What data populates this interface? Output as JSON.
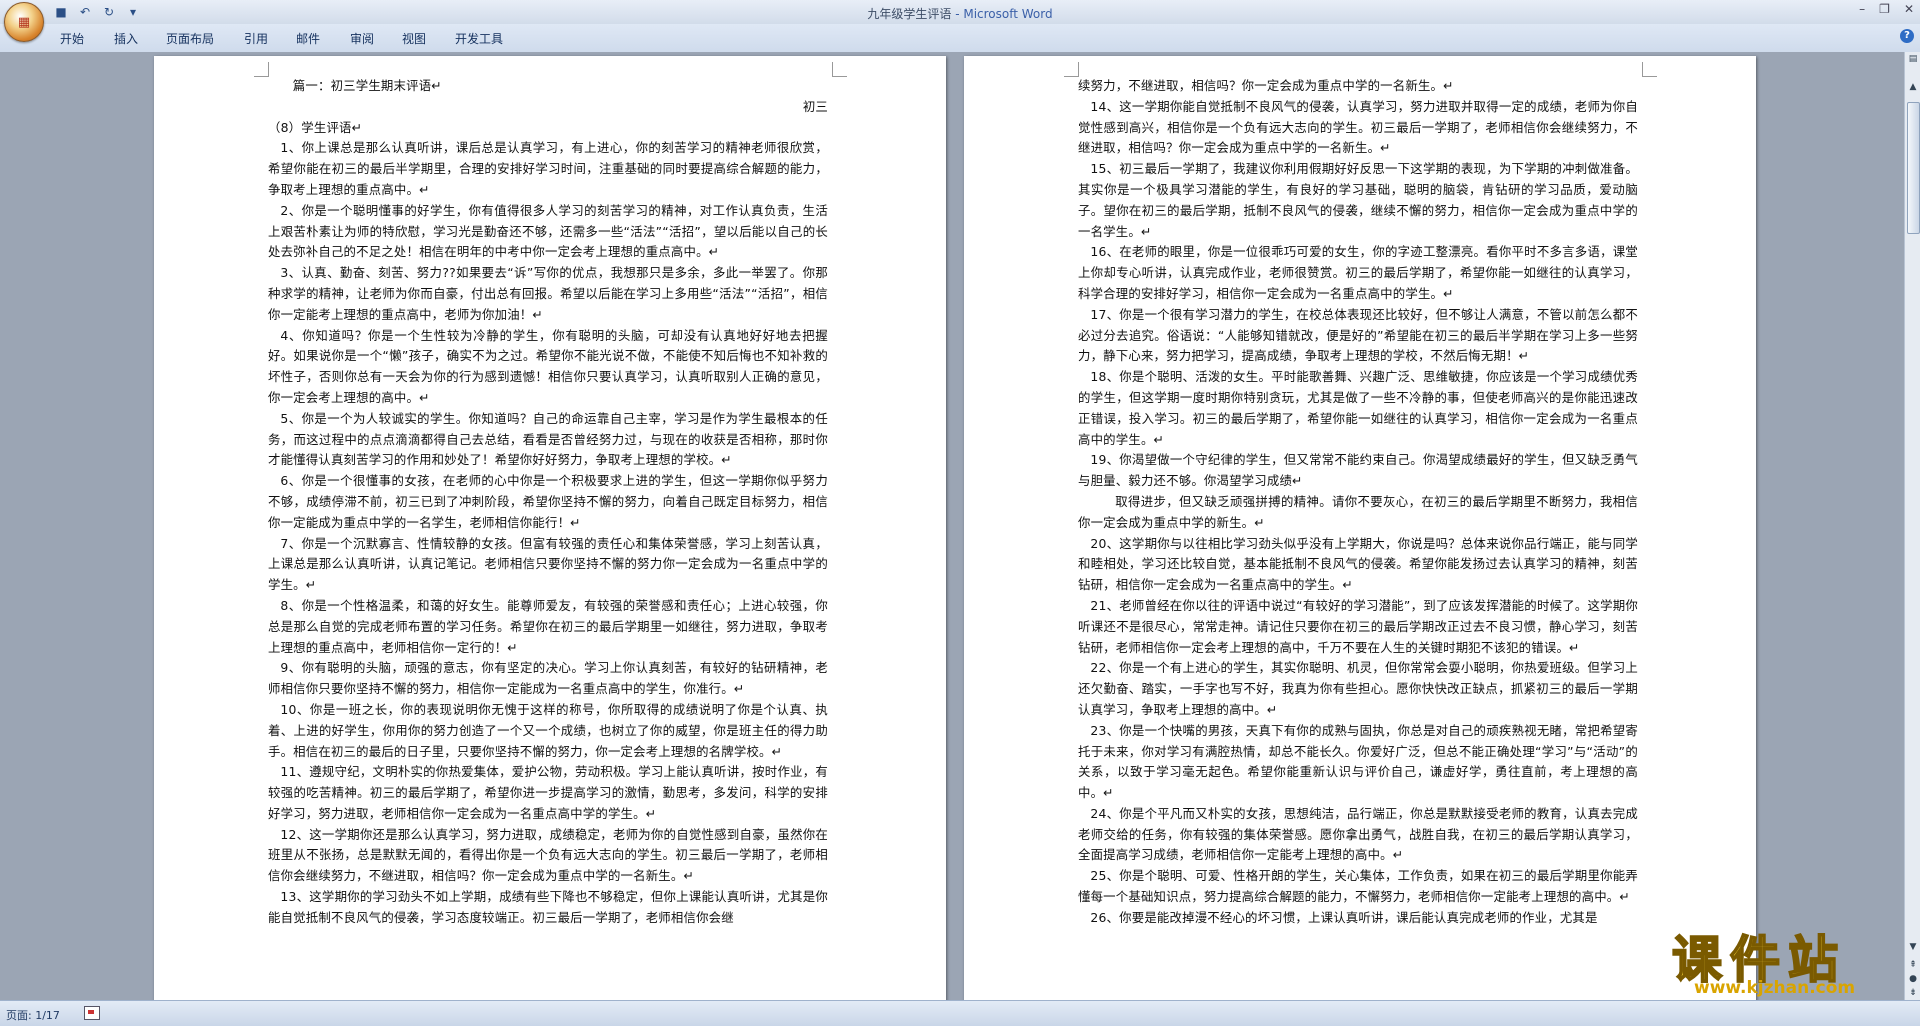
{
  "window": {
    "doc_title": "九年级学生评语",
    "app_title": " - Microsoft Word"
  },
  "office_button": {
    "icon": "office-logo-icon"
  },
  "quick_access": [
    {
      "name": "save-icon",
      "glyph": "💾"
    },
    {
      "name": "undo-icon",
      "glyph": "↶"
    },
    {
      "name": "redo-icon",
      "glyph": "↻"
    },
    {
      "name": "customize-qat-icon",
      "glyph": "▾"
    }
  ],
  "ribbon_tabs": [
    "开始",
    "插入",
    "页面布局",
    "引用",
    "邮件",
    "审阅",
    "视图",
    "开发工具"
  ],
  "page1": {
    "paragraphs": [
      {
        "cls": "heading",
        "text": "篇一：初三学生期末评语↵"
      },
      {
        "cls": "right",
        "text": "初三"
      },
      {
        "cls": "noindent",
        "text": "（8）学生评语↵"
      },
      {
        "cls": "",
        "text": "1、你上课总是那么认真听讲，课后总是认真学习，有上进心，你的刻苦学习的精神老师很欣赏，希望你能在初三的最后半学期里，合理的安排好学习时间，注重基础的同时要提高综合解题的能力，争取考上理想的重点高中。↵"
      },
      {
        "cls": "",
        "text": "2、你是一个聪明懂事的好学生，你有值得很多人学习的刻苦学习的精神，对工作认真负责，生活上艰苦朴素让为师的特欣慰，学习光是勤奋还不够，还需多一些“活法”“活招”，望以后能以自己的长处去弥补自己的不足之处！相信在明年的中考中你一定会考上理想的重点高中。↵"
      },
      {
        "cls": "",
        "text": "3、认真、勤奋、刻苦、努力??如果要去“诉”写你的优点，我想那只是多余，多此一举罢了。你那种求学的精神，让老师为你而自豪，付出总有回报。希望以后能在学习上多用些“活法”“活招”，相信你一定能考上理想的重点高中，老师为你加油！↵"
      },
      {
        "cls": "",
        "text": "4、你知道吗？你是一个生性较为冷静的学生，你有聪明的头脑，可却没有认真地好好地去把握好。如果说你是一个“懒”孩子，确实不为之过。希望你不能光说不做，不能使不知后悔也不知补救的坏性子，否则你总有一天会为你的行为感到遗憾！相信你只要认真学习，认真听取别人正确的意见，你一定会考上理想的高中。↵"
      },
      {
        "cls": "",
        "text": "5、你是一个为人较诚实的学生。你知道吗？自己的命运靠自己主宰，学习是作为学生最根本的任务，而这过程中的点点滴滴都得自己去总结，看看是否曾经努力过，与现在的收获是否相称，那时你才能懂得认真刻苦学习的作用和妙处了！希望你好好努力，争取考上理想的学校。↵"
      },
      {
        "cls": "",
        "text": "6、你是一个很懂事的女孩，在老师的心中你是一个积极要求上进的学生，但这一学期你似乎努力不够，成绩停滞不前，初三已到了冲刺阶段，希望你坚持不懈的努力，向着自己既定目标努力，相信你一定能成为重点中学的一名学生，老师相信你能行！↵"
      },
      {
        "cls": "",
        "text": "7、你是一个沉默寡言、性情较静的女孩。但富有较强的责任心和集体荣誉感，学习上刻苦认真，上课总是那么认真听讲，认真记笔记。老师相信只要你坚持不懈的努力你一定会成为一名重点中学的学生。↵"
      },
      {
        "cls": "",
        "text": "8、你是一个性格温柔，和蔼的好女生。能尊师爱友，有较强的荣誉感和责任心；上进心较强，你总是那么自觉的完成老师布置的学习任务。希望你在初三的最后学期里一如继往，努力进取，争取考上理想的重点高中，老师相信你一定行的！↵"
      },
      {
        "cls": "",
        "text": "9、你有聪明的头脑，顽强的意志，你有坚定的决心。学习上你认真刻苦，有较好的钻研精神，老师相信你只要你坚持不懈的努力，相信你一定能成为一名重点高中的学生，你准行。↵"
      },
      {
        "cls": "",
        "text": "10、你是一班之长，你的表现说明你无愧于这样的称号，你所取得的成绩说明了你是个认真、执着、上进的好学生，你用你的努力创造了一个又一个成绩，也树立了你的威望，你是班主任的得力助手。相信在初三的最后的日子里，只要你坚持不懈的努力，你一定会考上理想的名牌学校。↵"
      },
      {
        "cls": "",
        "text": "11、遵规守纪，文明朴实的你热爱集体，爱护公物，劳动积极。学习上能认真听讲，按时作业，有较强的吃苦精神。初三的最后学期了，希望你进一步提高学习的激情，勤思考，多发问，科学的安排好学习，努力进取，老师相信你一定会成为一名重点高中学的学生。↵"
      },
      {
        "cls": "",
        "text": "12、这一学期你还是那么认真学习，努力进取，成绩稳定，老师为你的自觉性感到自豪，虽然你在班里从不张扬，总是默默无闻的，看得出你是一个负有远大志向的学生。初三最后一学期了，老师相信你会继续努力，不继进取，相信吗？你一定会成为重点中学的一名新生。↵"
      },
      {
        "cls": "",
        "text": "13、这学期你的学习劲头不如上学期，成绩有些下降也不够稳定，但你上课能认真听讲，尤其是你能自觉抵制不良风气的侵袭，学习态度较端正。初三最后一学期了，老师相信你会继"
      }
    ]
  },
  "page2": {
    "paragraphs": [
      {
        "cls": "noindent",
        "text": "续努力，不继进取，相信吗？你一定会成为重点中学的一名新生。↵"
      },
      {
        "cls": "",
        "text": "14、这一学期你能自觉抵制不良风气的侵袭，认真学习，努力进取并取得一定的成绩，老师为你自觉性感到高兴，相信你是一个负有远大志向的学生。初三最后一学期了，老师相信你会继续努力，不继进取，相信吗？你一定会成为重点中学的一名新生。↵"
      },
      {
        "cls": "",
        "text": "15、初三最后一学期了，我建议你利用假期好好反思一下这学期的表现，为下学期的冲刺做准备。其实你是一个极具学习潜能的学生，有良好的学习基础，聪明的脑袋，肯钻研的学习品质，爱动脑子。望你在初三的最后学期，抵制不良风气的侵袭，继续不懈的努力，相信你一定会成为重点中学的一名学生。↵"
      },
      {
        "cls": "",
        "text": "16、在老师的眼里，你是一位很乖巧可爱的女生，你的字迹工整漂亮。看你平时不多言多语，课堂上你却专心听讲，认真完成作业，老师很赞赏。初三的最后学期了，希望你能一如继往的认真学习，科学合理的安排好学习，相信你一定会成为一名重点高中的学生。↵"
      },
      {
        "cls": "",
        "text": "17、你是一个很有学习潜力的学生，在校总体表现还比较好，但不够让人满意，不管以前怎么都不必过分去追究。俗语说：“人能够知错就改，便是好的”希望能在初三的最后半学期在学习上多一些努力，静下心来，努力把学习，提高成绩，争取考上理想的学校，不然后悔无期！↵"
      },
      {
        "cls": "",
        "text": "18、你是个聪明、活泼的女生。平时能歌善舞、兴趣广泛、思维敏捷，你应该是一个学习成绩优秀的学生，但这学期一度时期你特别贪玩，尤其是做了一些不冷静的事，但使老师高兴的是你能迅速改正错误，投入学习。初三的最后学期了，希望你能一如继往的认真学习，相信你一定会成为一名重点高中的学生。↵"
      },
      {
        "cls": "",
        "text": "19、你渴望做一个守纪律的学生，但又常常不能约束自己。你渴望成绩最好的学生，但又缺乏勇气与胆量、毅力还不够。你渴望学习成绩↵"
      },
      {
        "cls": "indent2",
        "text": "取得进步，但又缺乏顽强拼搏的精神。请你不要灰心，在初三的最后学期里不断努力，我相信你一定会成为重点中学的新生。↵"
      },
      {
        "cls": "",
        "text": "20、这学期你与以往相比学习劲头似乎没有上学期大，你说是吗？总体来说你品行端正，能与同学和睦相处，学习还比较自觉，基本能抵制不良风气的侵袭。希望你能发扬过去认真学习的精神，刻苦钻研，相信你一定会成为一名重点高中的学生。↵"
      },
      {
        "cls": "",
        "text": "21、老师曾经在你以往的评语中说过“有较好的学习潜能”，到了应该发挥潜能的时候了。这学期你听课还不是很尽心，常常走神。请记住只要你在初三的最后学期改正过去不良习惯，静心学习，刻苦钻研，老师相信你一定会考上理想的高中，千万不要在人生的关键时期犯不该犯的错误。↵"
      },
      {
        "cls": "",
        "text": "22、你是一个有上进心的学生，其实你聪明、机灵，但你常常会耍小聪明，你热爱班级。但学习上还欠勤奋、踏实，一手字也写不好，我真为你有些担心。愿你快快改正缺点，抓紧初三的最后一学期认真学习，争取考上理想的高中。↵"
      },
      {
        "cls": "",
        "text": "23、你是一个快嘴的男孩，天真下有你的成熟与固执，你总是对自己的顽疾熟视无睹，常把希望寄托于未来，你对学习有满腔热情，却总不能长久。你爱好广泛，但总不能正确处理“学习”与“活动”的关系，以致于学习毫无起色。希望你能重新认识与评价自己，谦虚好学，勇往直前，考上理想的高中。↵"
      },
      {
        "cls": "",
        "text": "24、你是个平凡而又朴实的女孩，思想纯洁，品行端正，你总是默默接受老师的教育，认真去完成老师交给的任务，你有较强的集体荣誉感。愿你拿出勇气，战胜自我，在初三的最后学期认真学习，全面提高学习成绩，老师相信你一定能考上理想的高中。↵"
      },
      {
        "cls": "",
        "text": "25、你是个聪明、可爱、性格开朗的学生，关心集体，工作负责，如果在初三的最后学期里你能弄懂每一个基础知识点，努力提高综合解题的能力，不懈努力，老师相信你一定能考上理想的高中。↵"
      },
      {
        "cls": "",
        "text": "26、你要是能改掉漫不经心的坏习惯，上课认真听讲，课后能认真完成老师的作业，尤其是"
      }
    ]
  },
  "statusbar": {
    "page_label": "页面: 1/17"
  },
  "watermark": {
    "cn": "课件站",
    "url": "www.kjzhan.com"
  }
}
